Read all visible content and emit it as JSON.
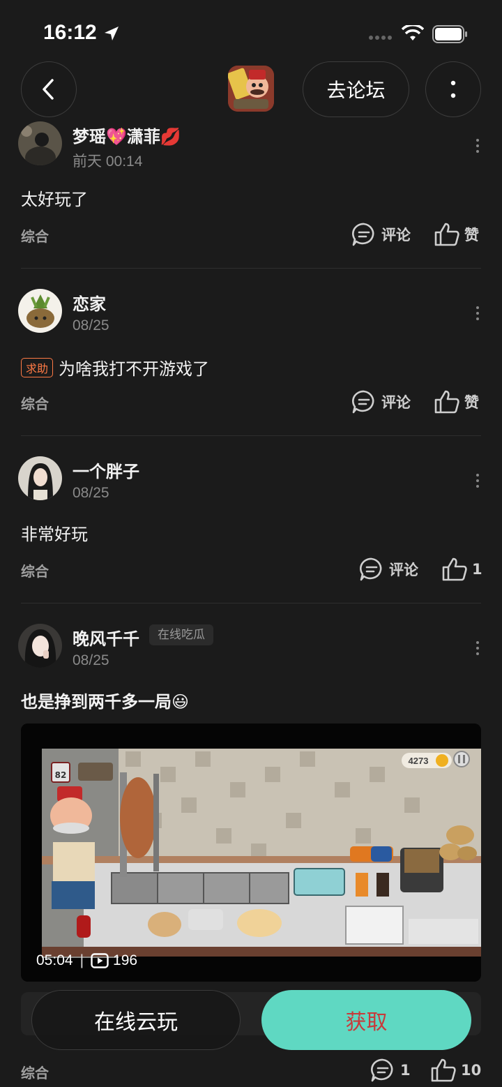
{
  "status_bar": {
    "time": "16:12"
  },
  "header": {
    "forum_button": "去论坛"
  },
  "posts": [
    {
      "username": "梦瑶💖潇菲💋",
      "time": "前天 00:14",
      "text": "太好玩了",
      "category": "综合",
      "comment_label": "评论",
      "like_label": "赞"
    },
    {
      "username": "恋家",
      "time": "08/25",
      "tag": "求助",
      "text": "为啥我打不开游戏了",
      "category": "综合",
      "comment_label": "评论",
      "like_label": "赞"
    },
    {
      "username": "一个胖子",
      "time": "08/25",
      "text": "非常好玩",
      "category": "综合",
      "comment_label": "评论",
      "like_count": "1"
    },
    {
      "username": "晚风千千",
      "badge": "在线吃瓜",
      "time": "08/25",
      "text": "也是挣到两千多一局😃",
      "video": {
        "duration": "05:04",
        "separator": "|",
        "plays": "196",
        "coins": "4273",
        "day": "82"
      },
      "category": "综合",
      "comment_count": "1",
      "like_count": "10"
    }
  ],
  "bottom": {
    "cloud_play": "在线云玩",
    "get": "获取"
  },
  "colors": {
    "accent": "#5fd8c2",
    "tag": "#ff7a45",
    "bg": "#1b1b1b"
  }
}
